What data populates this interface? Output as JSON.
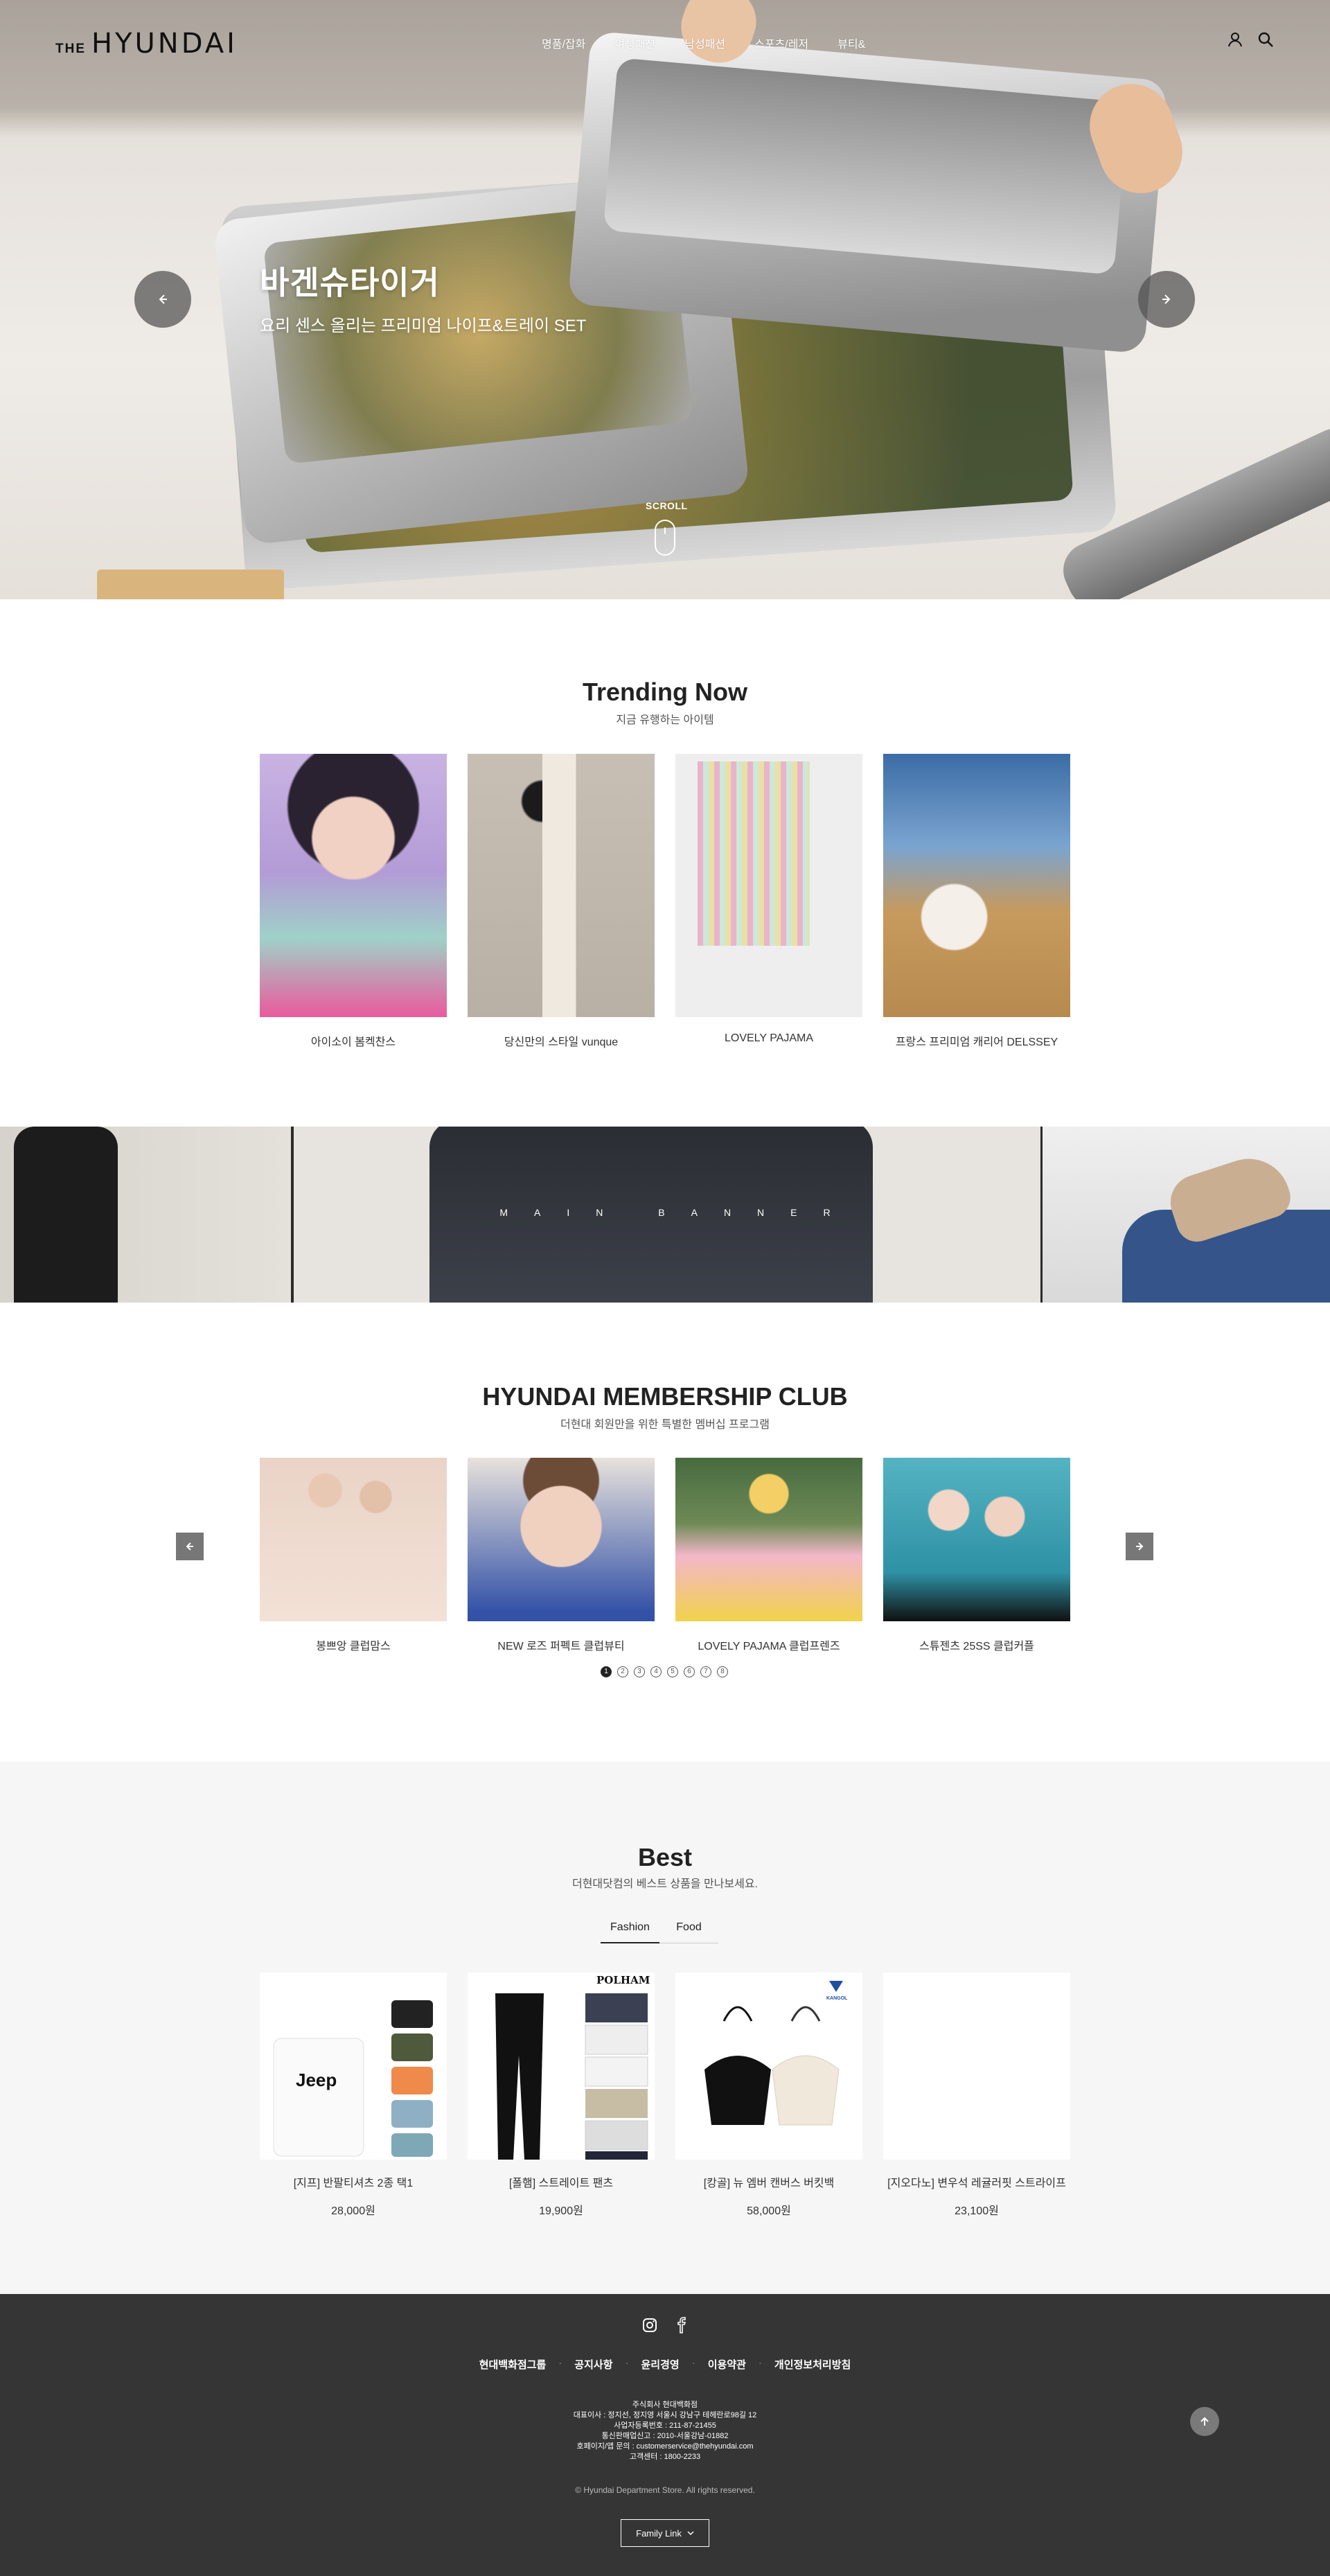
{
  "header": {
    "logo_the": "THE",
    "logo_main": "HYUNDAI",
    "nav": [
      "명품/잡화",
      "여성패션",
      "남성패션",
      "스포츠/레저",
      "뷰티&"
    ],
    "icons": [
      "user-icon",
      "search-icon"
    ]
  },
  "hero": {
    "title": "바겐슈타이거",
    "subtitle": "요리 센스 올리는 프리미엄 나이프&트레이 SET",
    "scroll_label": "SCROLL"
  },
  "trending": {
    "title": "Trending Now",
    "subtitle": "지금 유행하는 아이템",
    "items": [
      {
        "label": "아이소이 봄켁찬스"
      },
      {
        "label": "당신만의 스타일 vunque"
      },
      {
        "label": "LOVELY PAJAMA"
      },
      {
        "label": "프랑스 프리미엄 캐리어 DELSSEY"
      }
    ]
  },
  "main_banner": {
    "text": "MAIN BANNER"
  },
  "membership": {
    "title": "HYUNDAI MEMBERSHIP CLUB",
    "subtitle": "더현대 회원만을 위한 특별한 멤버십 프로그램",
    "items": [
      {
        "label": "봉쁘앙 클럽맘스"
      },
      {
        "label": "NEW 로즈 퍼펙트 클럽뷰티"
      },
      {
        "label": "LOVELY PAJAMA 클럽프렌즈"
      },
      {
        "label": "스튜젠츠 25SS 클럽커플"
      }
    ],
    "dots": [
      "1",
      "2",
      "3",
      "4",
      "5",
      "6",
      "7",
      "8"
    ],
    "active_dot": 1
  },
  "best": {
    "title": "Best",
    "subtitle": "더현대닷컴의 베스트 상품을 만나보세요.",
    "tabs": [
      "Fashion",
      "Food"
    ],
    "active_tab": "Fashion",
    "items": [
      {
        "label": "[지프] 반팔티셔츠 2종 택1",
        "price": "28,000원",
        "img_text": "Jeep"
      },
      {
        "label": "[폴햄] 스트레이트 팬츠",
        "price": "19,900원",
        "img_text": "POLHAM"
      },
      {
        "label": "[캉골] 뉴 엠버 캔버스 버킷백",
        "price": "58,000원",
        "img_text": "KANGOL"
      },
      {
        "label": "[지오다노] 변우석 레귤러핏 스트라이프",
        "price": "23,100원",
        "img_text": ""
      }
    ]
  },
  "footer": {
    "social": [
      "instagram-icon",
      "facebook-icon"
    ],
    "links": [
      "현대백화점그룹",
      "공지사항",
      "윤리경영",
      "이용약관",
      "개인정보처리방침"
    ],
    "info": [
      "주식회사 현대백화점",
      "대표이사 : 정지선, 정지영 서울시 강남구 테헤란로98길 12",
      "사업자등록번호 : 211-87-21455",
      "통신판매업신고 : 2010-서울강남-01882",
      "호페이지/앱 문의 : customerservice@thehyundai.com",
      "고객센터 : 1800-2233"
    ],
    "copyright": "© Hyundai Department Store. All rights reserved.",
    "family_link": "Family Link"
  }
}
